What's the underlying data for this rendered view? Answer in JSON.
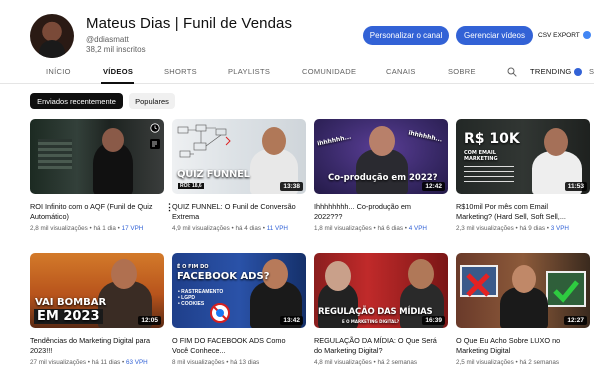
{
  "channel": {
    "title": "Mateus Dias | Funil de Vendas",
    "handle": "@ddiasmatt",
    "subscribers": "38,2 mil inscritos",
    "customize_label": "Personalizar o canal",
    "manage_label": "Gerenciar vídeos",
    "csv_label": "CSV EXPORT"
  },
  "tabs": [
    "INÍCIO",
    "VÍDEOS",
    "SHORTS",
    "PLAYLISTS",
    "COMUNIDADE",
    "CANAIS",
    "SOBRE",
    "TRENDING",
    "S"
  ],
  "active_tab": "VÍDEOS",
  "filters": [
    "Enviados recentemente",
    "Populares"
  ],
  "active_filter": "Enviados recentemente",
  "videos": [
    {
      "title": "ROI Infinito com o AQF (Funil de Quiz Automático)",
      "views": "2,8 mil visualizações",
      "age": "há 1 dia",
      "vph": "17 VPH",
      "duration": ""
    },
    {
      "title": "QUIZ FUNNEL: O Funil de Conversão Extrema",
      "views": "4,9 mil visualizações",
      "age": "há 4 dias",
      "vph": "11 VPH",
      "duration": "13:38",
      "overlay": "QUIZ FUNNEL",
      "overlay2": "ROI: 18,6"
    },
    {
      "title": "Ihhhhhhhh... Co-produção em 2022???",
      "views": "1,8 mil visualizações",
      "age": "há 6 dias",
      "vph": "4 VPH",
      "duration": "12:42",
      "overlay": "Co-produção em 2022?",
      "overlay2": "ihhhhhh..."
    },
    {
      "title": "R$10mil Por mês com Email Marketing? (Hard Sell, Soft Sell,...",
      "views": "2,3 mil visualizações",
      "age": "há 9 dias",
      "vph": "3 VPH",
      "duration": "11:53",
      "overlay": "R$ 10K",
      "overlay2": "COM EMAIL MARKETING"
    },
    {
      "title": "Tendências do Marketing Digital para 2023!!!",
      "views": "27 mil visualizações",
      "age": "há 11 dias",
      "vph": "63 VPH",
      "duration": "12:05",
      "overlay": "VAI BOMBAR",
      "overlay2": "EM 2023"
    },
    {
      "title": "O FIM DO FACEBOOK ADS Como Você Conhece...",
      "views": "8 mil visualizações",
      "age": "há 13 dias",
      "vph": "",
      "duration": "13:42",
      "overlay": "FACEBOOK ADS?",
      "overlay2": "É O FIM DO"
    },
    {
      "title": "REGULAÇÃO DA MÍDIA: O Que Será do Marketing Digital?",
      "views": "4,8 mil visualizações",
      "age": "há 2 semanas",
      "vph": "",
      "duration": "16:39",
      "overlay": "REGULAÇÃO DAS MÍDIAS",
      "overlay2": "E O MARKETING DIGITAL?"
    },
    {
      "title": "O Que Eu Acho Sobre LUXO no Marketing Digital",
      "views": "2,5 mil visualizações",
      "age": "há 2 semanas",
      "vph": "",
      "duration": "12:27"
    }
  ],
  "colors": {
    "accent": "#3262d6",
    "vph": "#3262d6"
  }
}
